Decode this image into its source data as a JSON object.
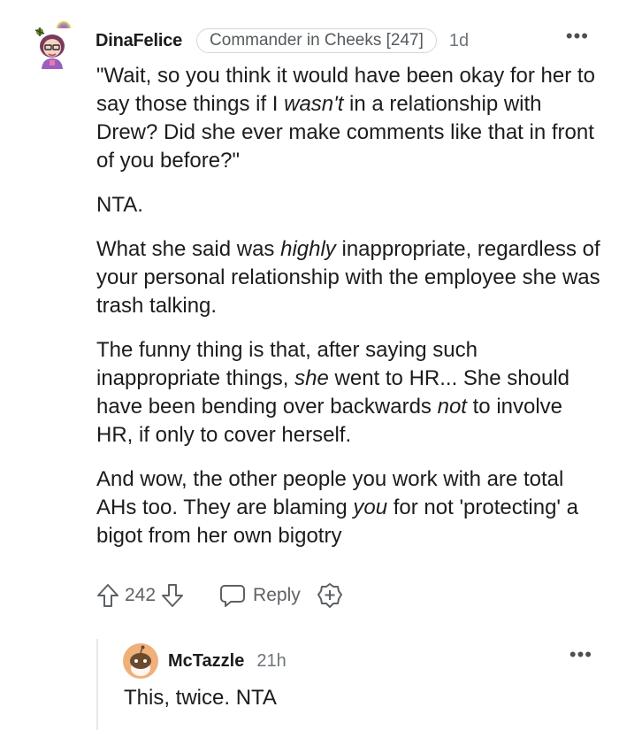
{
  "comment": {
    "author": "DinaFelice",
    "flair": "Commander in Cheeks [247]",
    "age": "1d",
    "more": "•••",
    "p1_a": "\"Wait, so you think it would have been okay for her to say those things if I ",
    "p1_em": "wasn't",
    "p1_b": " in a relationship with Drew? Did she ever make comments like that in front of you before?\"",
    "p2": "NTA.",
    "p3_a": "What she said was ",
    "p3_em": "highly",
    "p3_b": " inappropriate, regardless of your personal relationship with the employee she was trash talking.",
    "p4_a": "The funny thing is that, after saying such inappropriate things, ",
    "p4_em1": "she",
    "p4_b": " went to HR... She should have been bending over backwards ",
    "p4_em2": "not",
    "p4_c": " to involve HR, if only to cover herself.",
    "p5_a": "And wow, the other people you work with are total AHs too. They are blaming ",
    "p5_em": "you",
    "p5_b": " for not 'protecting' a bigot from her own bigotry"
  },
  "actions": {
    "score": "242",
    "reply_label": "Reply",
    "icons": [
      "upvote-icon",
      "downvote-icon",
      "reply-icon",
      "award-icon"
    ]
  },
  "reply": {
    "author": "McTazzle",
    "age": "21h",
    "more": "•••",
    "text": "This, twice. NTA"
  },
  "colors": {
    "text": "#1c1c1c",
    "muted": "#6f7478",
    "border": "#d4d7da",
    "reply_avatar": "#f0b07a"
  }
}
